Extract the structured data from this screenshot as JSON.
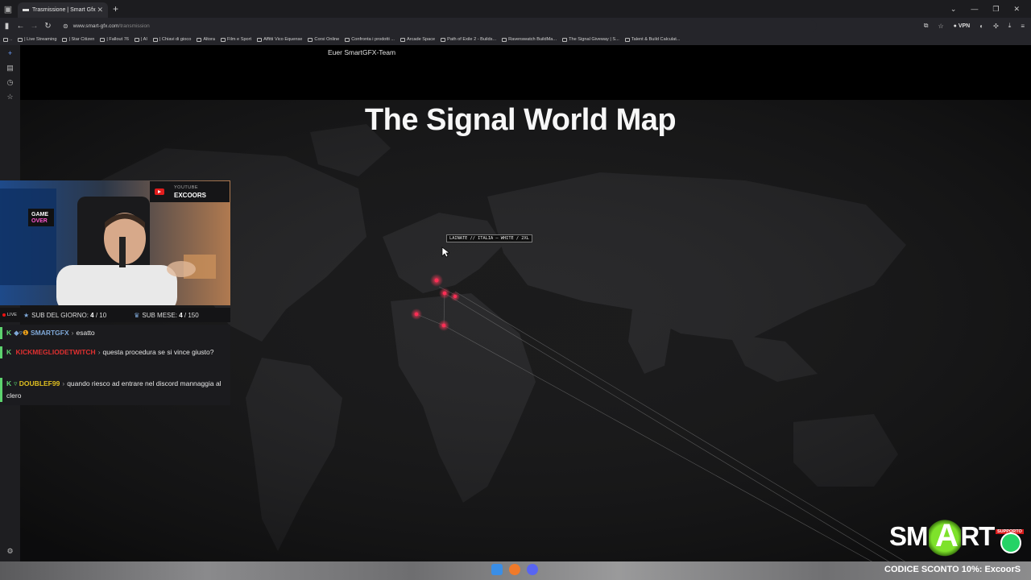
{
  "browser": {
    "tab_title": "Trasmissione | Smart Gfx",
    "url_host": "www.smart-gfx.com",
    "url_path": "/transmission",
    "vpn_label": "VPN"
  },
  "bookmarks": [
    "| Live Streaming",
    "| Star Citizen",
    "| Fallout 76",
    "| AI",
    "| Chiavi di gioco",
    "Altora",
    "Film e Sport",
    "Affitti Vico Equense",
    "Corsi Online",
    "Confronta i prodotti ...",
    "Arcade Space",
    "Path of Exile 2 - Builds...",
    "Ravenswatch BuildMa...",
    "The Signal Giveway | S...",
    "Talent & Build Calculat..."
  ],
  "page": {
    "team_text": "Euer SmartGFX-Team",
    "map_title": "The Signal World Map",
    "tooltip": "LAINATE // ITALIA  –  WHITE / 2XL",
    "marker_color": "#ff2d55",
    "line_color": "#8a8a8a"
  },
  "overlay": {
    "yt_small": "YOUTUBE",
    "yt_channel": "EXCOORS",
    "live": "LIVE",
    "sub_day_label": "SUB DEL GIORNO:",
    "sub_day_value": "4",
    "sub_day_goal": "/ 10",
    "sub_month_label": "SUB MESE:",
    "sub_month_value": "4",
    "sub_month_goal": "/ 150",
    "chat": [
      {
        "user": "SMARTGFX",
        "color": "#7fa8d8",
        "text": "esatto"
      },
      {
        "user": "KICKMEGLIODETWITCH",
        "color": "#e03030",
        "text": "questa procedura se si vince giusto?"
      },
      {
        "user": "DOUBLEF99",
        "color": "#e0c020",
        "text": "quando riesco ad entrare nel discord mannaggia al clero"
      }
    ]
  },
  "logo": {
    "supporto": "SUPPORTO",
    "codice": "CODICE SCONTO 10%: ExcoorS"
  }
}
